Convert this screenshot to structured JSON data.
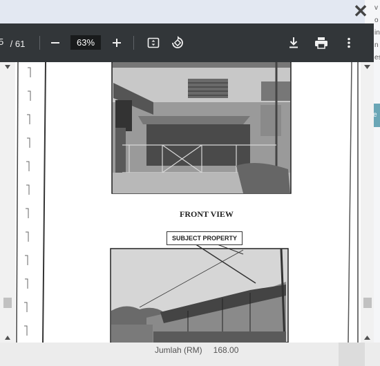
{
  "background": {
    "right_text_lines": [
      "v",
      "o",
      "in",
      "n",
      "es"
    ],
    "teal_tab_text": "e",
    "footer_label": "Jumlah (RM)",
    "footer_value": "168.00"
  },
  "viewer": {
    "page_current": "5",
    "page_total": "/ 61",
    "zoom": "63%",
    "icons": [
      "minus-icon",
      "plus-icon",
      "fit-page-icon",
      "rotate-icon",
      "download-icon",
      "print-icon",
      "more-icon"
    ]
  },
  "document": {
    "caption": "FRONT VIEW",
    "label": "SUBJECT PROPERTY"
  }
}
